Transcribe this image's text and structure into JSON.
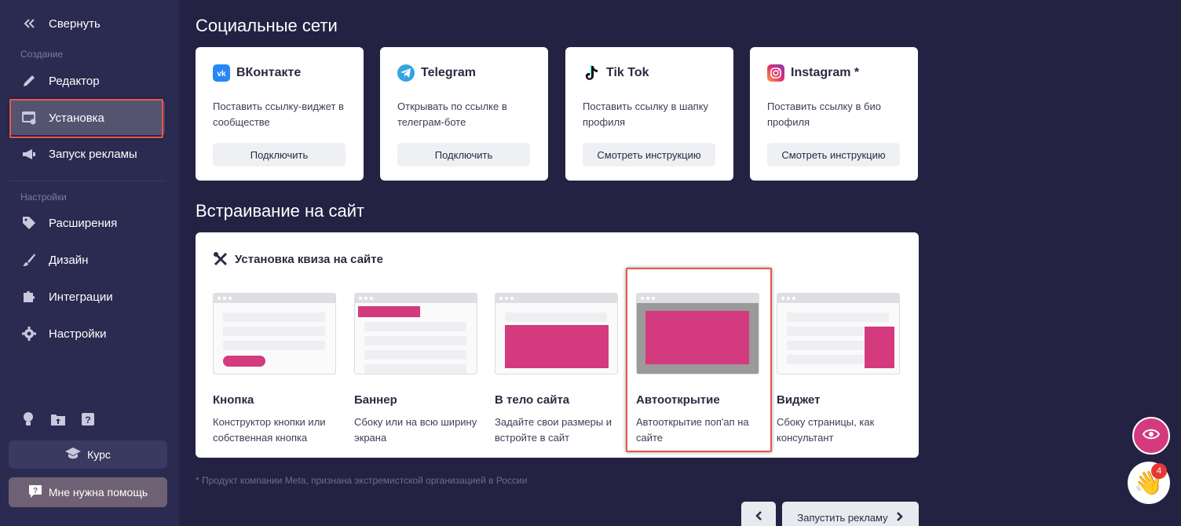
{
  "sidebar": {
    "collapse_label": "Свернуть",
    "section_create": "Создание",
    "section_settings": "Настройки",
    "items": {
      "editor": "Редактор",
      "install": "Установка",
      "ads": "Запуск рекламы",
      "extensions": "Расширения",
      "design": "Дизайн",
      "integrations": "Интеграции",
      "settings": "Настройки"
    },
    "course_label": "Курс",
    "help_label": "Мне нужна помощь"
  },
  "social": {
    "title": "Социальные сети",
    "cards": [
      {
        "name": "ВКонтакте",
        "desc": "Поставить ссылку-виджет в сообществе",
        "button": "Подключить"
      },
      {
        "name": "Telegram",
        "desc": "Открывать по ссылке в телеграм-боте",
        "button": "Подключить"
      },
      {
        "name": "Tik Tok",
        "desc": "Поставить ссылку в шапку профиля",
        "button": "Смотреть инструкцию"
      },
      {
        "name": "Instagram *",
        "desc": "Поставить ссылку в био профиля",
        "button": "Смотреть инструкцию"
      }
    ]
  },
  "embed": {
    "title": "Встраивание на сайт",
    "card_title": "Установка квиза на сайте",
    "options": [
      {
        "name": "Кнопка",
        "desc": "Конструктор кнопки или собственная кнопка"
      },
      {
        "name": "Баннер",
        "desc": "Сбоку или на всю ширину экрана"
      },
      {
        "name": "В тело сайта",
        "desc": "Задайте свои размеры и встройте в сайт"
      },
      {
        "name": "Автооткрытие",
        "desc": "Автооткрытие поп'ап на сайте"
      },
      {
        "name": "Виджет",
        "desc": "Сбоку страницы, как консультант"
      }
    ]
  },
  "footnote": "* Продукт компании Meta, признана экстремистской организацией в России",
  "nav": {
    "next_label": "Запустить рекламу"
  },
  "badge_count": "4",
  "colors": {
    "accent": "#d43a7e",
    "sidebar_bg": "#2b2a50",
    "page_bg": "#232243",
    "highlight": "#e8574b"
  }
}
